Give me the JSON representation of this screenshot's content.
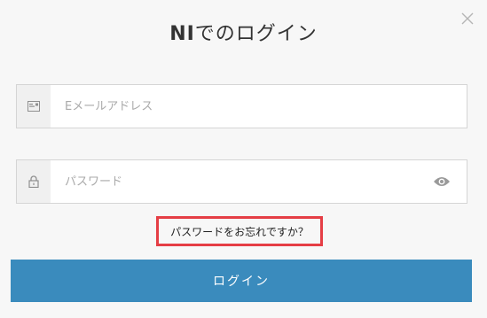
{
  "dialog": {
    "title_brand": "NI",
    "title_rest": "でのログイン",
    "close_icon": "close-icon"
  },
  "email": {
    "placeholder": "Eメールアドレス",
    "value": "",
    "icon": "envelope-icon"
  },
  "password": {
    "placeholder": "パスワード",
    "value": "",
    "icon": "lock-icon",
    "toggle_icon": "eye-icon"
  },
  "forgot_link": "パスワードをお忘れですか？",
  "login_button": "ログイン",
  "colors": {
    "accent": "#3a8bbd",
    "highlight_border": "#e53e45",
    "background": "#f7f7f7"
  }
}
